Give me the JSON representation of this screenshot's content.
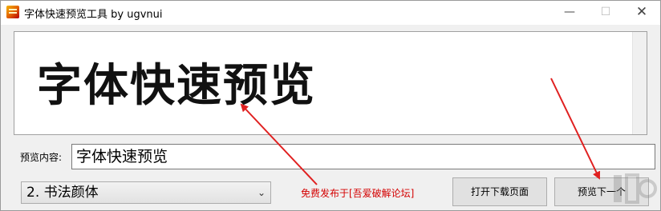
{
  "window": {
    "title": "字体快速预览工具 by ugvnui",
    "minimize_glyph": "—",
    "maximize_glyph": "☐",
    "close_glyph": "✕"
  },
  "preview": {
    "sample_text": "字体快速预览"
  },
  "content": {
    "label": "预览内容:",
    "value": "字体快速预览"
  },
  "font_select": {
    "selected": "2. 书法颜体",
    "arrow_glyph": "⌄"
  },
  "notice": {
    "text": "免费发布于[吾爱破解论坛]",
    "color": "#d40000"
  },
  "buttons": {
    "open_download": "打开下载页面",
    "next": "预览下一个"
  },
  "annotations": {
    "arrow_color": "#e02020"
  }
}
